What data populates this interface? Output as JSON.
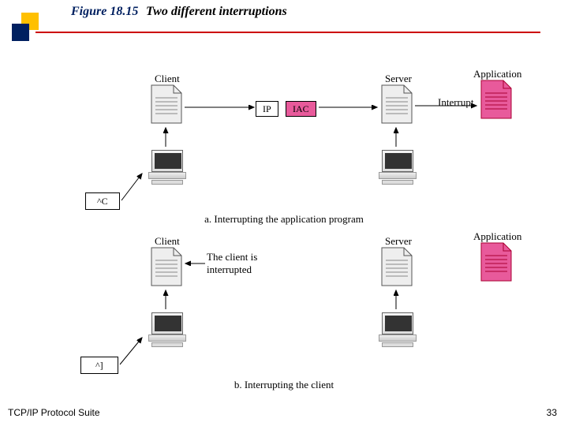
{
  "header": {
    "figure_no": "Figure 18.15",
    "figure_title": "Two different interruptions"
  },
  "footer": {
    "book": "TCP/IP Protocol Suite",
    "page": "33"
  },
  "diagram": {
    "part_a": {
      "caption": "a. Interrupting the application program",
      "labels": {
        "client": "Client",
        "server": "Server",
        "application": "Application",
        "interrupt": "Interrupt"
      },
      "boxes": {
        "ip": "IP",
        "iac": "IAC",
        "ctrl_c": "^C"
      }
    },
    "part_b": {
      "caption": "b. Interrupting the client",
      "labels": {
        "client": "Client",
        "server": "Server",
        "application": "Application",
        "interrupted": "The client is\ninterrupted"
      },
      "boxes": {
        "ctrl_bracket": "^]"
      }
    }
  }
}
